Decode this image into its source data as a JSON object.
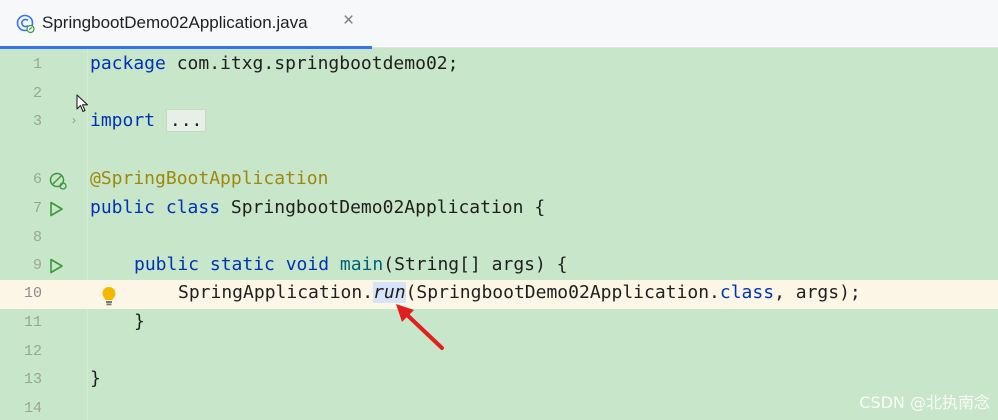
{
  "tab": {
    "title": "SpringbootDemo02Application.java",
    "close_glyph": "×",
    "icon": "spring-class-icon"
  },
  "colors": {
    "editor_bg": "#c8e6c9",
    "keyword": "#0033b3",
    "annotation": "#9e880d",
    "method_decl": "#00627a",
    "current_line_bg": "#fbf6e6",
    "run_icon": "#3a9a3a",
    "arrow": "#e02020",
    "tab_underline": "#3574f0"
  },
  "editor": {
    "line_numbers": [
      "1",
      "2",
      "3",
      "",
      "6",
      "7",
      "8",
      "9",
      "10",
      "11",
      "12",
      "13",
      "14"
    ],
    "lines": {
      "l1_kw": "package",
      "l1_rest": " com.itxg.springbootdemo02;",
      "l3_kw": "import",
      "l3_fold": "...",
      "l6_ann": "@SpringBootApplication",
      "l7_kw": "public class",
      "l7_rest": " SpringbootDemo02Application {",
      "l9_kw": "public static void",
      "l9_fn": "main",
      "l9_rest": "(String[] args) {",
      "l10_pre": "SpringApplication.",
      "l10_fn": "run",
      "l10_mid": "(SpringbootDemo02Application.",
      "l10_kw": "class",
      "l10_post": ", args);",
      "l11": "}",
      "l13": "}"
    }
  },
  "icons": {
    "gutter_run_line7": "run-icon",
    "gutter_run_line9": "run-icon",
    "gutter_bean_line6": "spring-bean-icon",
    "fold_line3": "fold-chevron-icon",
    "intention_line10": "lightbulb-icon",
    "annotation_arrow": "red-arrow-icon",
    "mouse_cursor": "mouse-cursor-icon"
  },
  "watermark": "CSDN @北执南念"
}
